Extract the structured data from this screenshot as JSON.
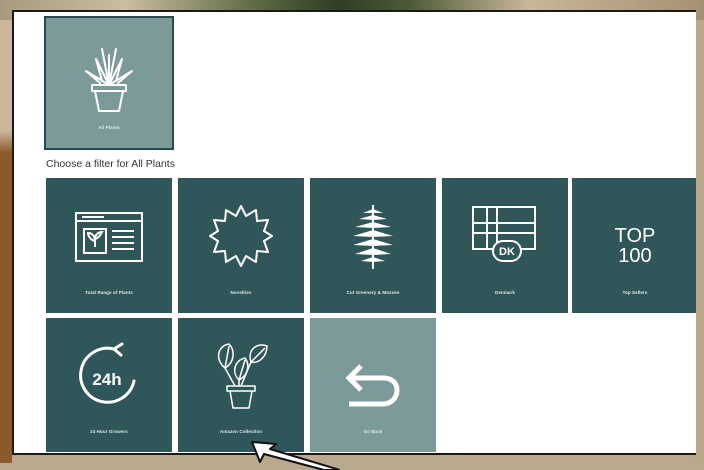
{
  "selected_category": {
    "label": "All Plants",
    "icon": "potted-plant-icon"
  },
  "filter_heading": "Choose a filter for All Plants",
  "filters": [
    {
      "label": "Total Range of Plants",
      "icon": "plant-catalog-icon"
    },
    {
      "label": "Novelties",
      "icon": "starburst-icon"
    },
    {
      "label": "Cut Greenery & Mosses",
      "icon": "fern-leaf-icon"
    },
    {
      "label": "Denmark",
      "icon": "denmark-flag-icon",
      "badge": "DK"
    },
    {
      "label": "Top Sellers",
      "icon": "top-100-icon",
      "badge": "TOP\n100"
    },
    {
      "label": "24 Hour Growers",
      "icon": "24h-icon",
      "badge": "24h"
    },
    {
      "label": "Amazon Collection",
      "icon": "alocasia-plant-icon"
    },
    {
      "label": "Go Back",
      "icon": "back-arrow-icon"
    }
  ],
  "colors": {
    "tile": "#2f5659",
    "tile_light": "#7d9a9b",
    "panel": "#ffffff"
  }
}
